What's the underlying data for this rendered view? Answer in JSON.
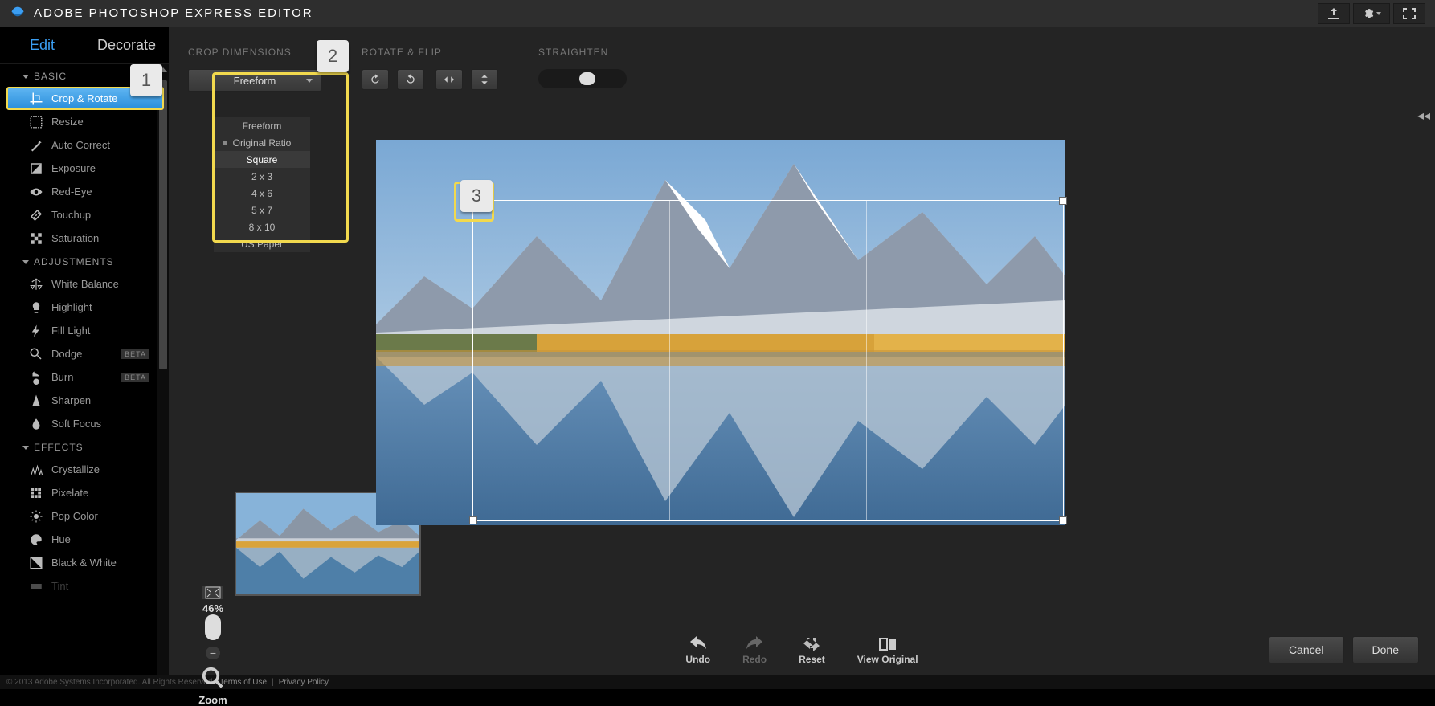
{
  "app_title": "ADOBE PHOTOSHOP EXPRESS EDITOR",
  "mode_tabs": {
    "edit": "Edit",
    "decorate": "Decorate"
  },
  "sections": {
    "basic": {
      "title": "BASIC",
      "items": [
        "Crop & Rotate",
        "Resize",
        "Auto Correct",
        "Exposure",
        "Red-Eye",
        "Touchup",
        "Saturation"
      ]
    },
    "adjustments": {
      "title": "ADJUSTMENTS",
      "items": [
        "White Balance",
        "Highlight",
        "Fill Light",
        "Dodge",
        "Burn",
        "Sharpen",
        "Soft Focus"
      ]
    },
    "effects": {
      "title": "EFFECTS",
      "items": [
        "Crystallize",
        "Pixelate",
        "Pop Color",
        "Hue",
        "Black & White",
        "Tint"
      ]
    }
  },
  "badges": {
    "dodge": "BETA",
    "burn": "BETA"
  },
  "workspace": {
    "crop_dimensions_label": "CROP DIMENSIONS",
    "rotate_flip_label": "ROTATE & FLIP",
    "straighten_label": "STRAIGHTEN",
    "crop_select_value": "Freeform",
    "crop_options": [
      "Freeform",
      "Original Ratio",
      "Square",
      "2 x 3",
      "4 x 6",
      "5 x 7",
      "8 x 10",
      "US Paper"
    ],
    "crop_option_current": "Original Ratio",
    "crop_option_hover": "Square"
  },
  "zoom": {
    "percent": "46%",
    "label": "Zoom"
  },
  "bottom": {
    "undo": "Undo",
    "redo": "Redo",
    "reset": "Reset",
    "view_original": "View Original",
    "cancel": "Cancel",
    "done": "Done"
  },
  "callouts": {
    "c1": "1",
    "c2": "2",
    "c3": "3"
  },
  "footer": {
    "copyright": "© 2013 Adobe Systems Incorporated. All Rights Reserved.",
    "terms": "Terms of Use",
    "privacy": "Privacy Policy"
  }
}
